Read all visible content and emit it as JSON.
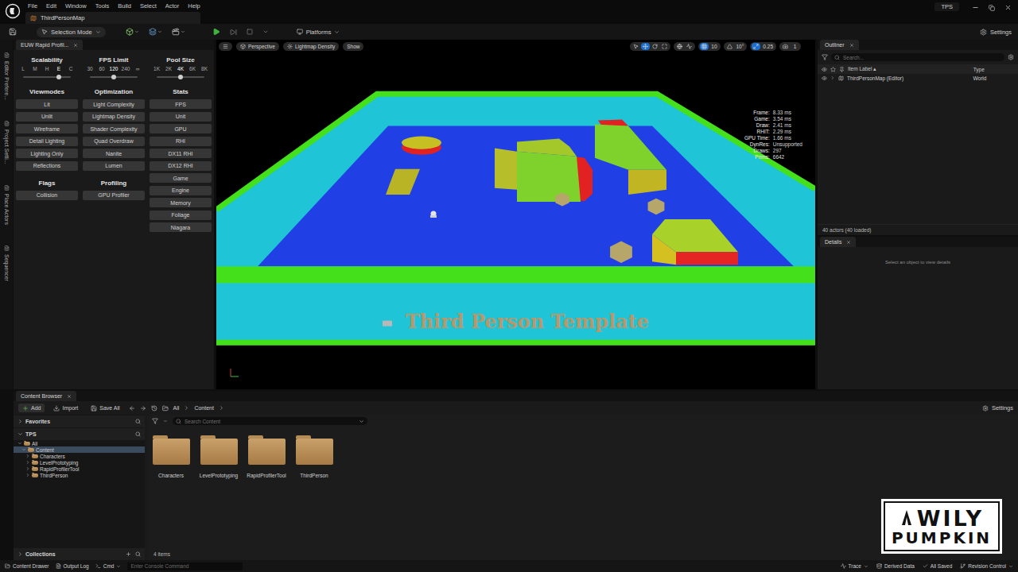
{
  "title_bar": {
    "menu": [
      "File",
      "Edit",
      "Window",
      "Tools",
      "Build",
      "Select",
      "Actor",
      "Help"
    ],
    "document_tab": "ThirdPersonMap",
    "project": "TPS"
  },
  "main_toolbar": {
    "mode": "Selection Mode",
    "platforms": "Platforms",
    "settings": "Settings"
  },
  "side_tabs": [
    "Editor Prefere...",
    "Project Setti...",
    "Place Actors",
    "Sequencer"
  ],
  "profiler": {
    "tab": "EUW Rapid Profil...",
    "columns": [
      {
        "slider": {
          "title": "Scalability",
          "options": [
            {
              "label": "L",
              "selected": false
            },
            {
              "label": "M",
              "selected": false
            },
            {
              "label": "H",
              "selected": false
            },
            {
              "label": "E",
              "selected": true
            },
            {
              "label": "C",
              "selected": false
            }
          ]
        },
        "groups": [
          {
            "title": "Viewmodes",
            "buttons": [
              "Lit",
              "Unlit",
              "Wireframe",
              "Detail Lighting",
              "Lighting Only",
              "Reflections"
            ]
          },
          {
            "title": "Flags",
            "buttons": [
              "Collision"
            ]
          }
        ]
      },
      {
        "slider": {
          "title": "FPS Limit",
          "options": [
            {
              "label": "30",
              "selected": false
            },
            {
              "label": "60",
              "selected": false
            },
            {
              "label": "120",
              "selected": true
            },
            {
              "label": "240",
              "selected": false
            },
            {
              "label": "∞",
              "selected": false
            }
          ]
        },
        "groups": [
          {
            "title": "Optimization",
            "buttons": [
              "Light Complexity",
              "Lightmap Density",
              "Shader Complexity",
              "Quad Overdraw",
              "Nanite",
              "Lumen"
            ]
          },
          {
            "title": "Profiling",
            "buttons": [
              "GPU Profiler"
            ]
          }
        ]
      },
      {
        "slider": {
          "title": "Pool Size",
          "options": [
            {
              "label": "1K",
              "selected": false
            },
            {
              "label": "2K",
              "selected": false
            },
            {
              "label": "4K",
              "selected": true
            },
            {
              "label": "6K",
              "selected": false
            },
            {
              "label": "8K",
              "selected": false
            }
          ]
        },
        "groups": [
          {
            "title": "Stats",
            "buttons": [
              "FPS",
              "Unit",
              "GPU",
              "RHI",
              "DX11 RHI",
              "DX12 RHI",
              "Game",
              "Engine",
              "Memory",
              "Foliage",
              "Niagara"
            ]
          }
        ]
      }
    ]
  },
  "viewport": {
    "toolbar": {
      "view": "Perspective",
      "view_mode": "Lightmap Density",
      "show": "Show",
      "transform_tools": [
        {
          "kind": "select",
          "selected": false
        },
        {
          "kind": "translate",
          "selected": true
        },
        {
          "kind": "rotate",
          "selected": false
        },
        {
          "kind": "scale",
          "selected": false
        }
      ],
      "snaps": [
        {
          "kind": "grid",
          "value": "10",
          "on": true
        },
        {
          "kind": "rotation",
          "value": "10°",
          "on": false
        },
        {
          "kind": "scale",
          "value": "0.25",
          "on": true
        }
      ],
      "camera_speed": "1"
    },
    "stats": [
      {
        "label": "Frame:",
        "value": "8.33 ms"
      },
      {
        "label": "Game:",
        "value": "3.54 ms"
      },
      {
        "label": "Draw:",
        "value": "2.41 ms"
      },
      {
        "label": "RHIT:",
        "value": "2.29 ms"
      },
      {
        "label": "GPU Time:",
        "value": "1.66 ms"
      },
      {
        "label": "DynRes:",
        "value": "Unsupported"
      },
      {
        "label": "Draws:",
        "value": "297"
      },
      {
        "label": "Prims:",
        "value": "6642"
      }
    ],
    "scene_text": "Third Person Template"
  },
  "outliner": {
    "tab": "Outliner",
    "search_placeholder": "Search...",
    "columns": [
      "Item Label",
      "Type"
    ],
    "sort_indicator": "▴",
    "rows": [
      {
        "label": "ThirdPersonMap (Editor)",
        "type": "World",
        "expanded": false
      }
    ],
    "footer": "40 actors (40 loaded)"
  },
  "details": {
    "tab": "Details",
    "message": "Select an object to view details"
  },
  "content_browser": {
    "tab": "Content Browser",
    "add": "Add",
    "import": "Import",
    "save_all": "Save All",
    "path": [
      "All",
      "Content"
    ],
    "settings": "Settings",
    "favorites": "Favorites",
    "project": "TPS",
    "tree": [
      {
        "label": "All",
        "depth": 0,
        "expanded": true,
        "selected": false
      },
      {
        "label": "Content",
        "depth": 1,
        "expanded": true,
        "selected": true
      },
      {
        "label": "Characters",
        "depth": 2,
        "expanded": false,
        "selected": false
      },
      {
        "label": "LevelPrototyping",
        "depth": 2,
        "expanded": false,
        "selected": false
      },
      {
        "label": "RapidProfilerTool",
        "depth": 2,
        "expanded": false,
        "selected": false
      },
      {
        "label": "ThirdPerson",
        "depth": 2,
        "expanded": false,
        "selected": false
      }
    ],
    "collections": "Collections",
    "search_placeholder": "Search Content",
    "folders": [
      "Characters",
      "LevelPrototyping",
      "RapidProfilerTool",
      "ThirdPerson"
    ],
    "count": "4 items"
  },
  "status_bar": {
    "content_drawer": "Content Drawer",
    "output_log": "Output Log",
    "cmd": "Cmd",
    "console_placeholder": "Enter Console Command",
    "trace": "Trace",
    "derived_data": "Derived Data",
    "save_state": "All Saved",
    "revision_control": "Revision Control"
  },
  "watermark": {
    "lines": [
      "WILY",
      "PUMPKIN"
    ]
  }
}
